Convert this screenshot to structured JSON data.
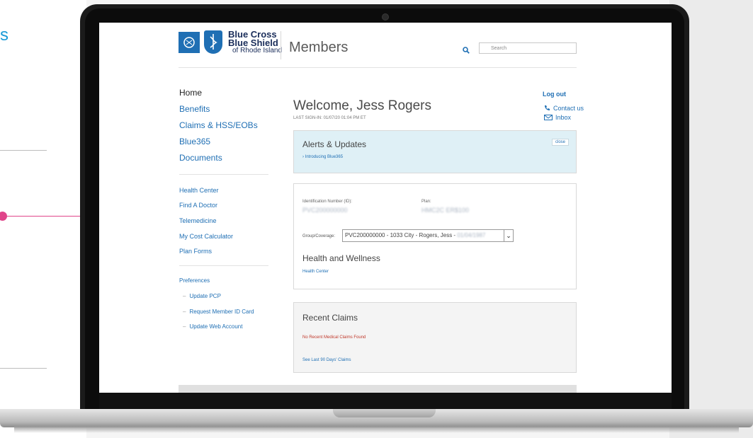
{
  "backdrop": {
    "left_letter": "s",
    "accent_color": "#e0448a",
    "brand_blue": "#1a9bd7"
  },
  "brand": {
    "line1": "Blue Cross",
    "line2": "Blue Shield",
    "line3": "of Rhode Island",
    "logo_icons": [
      "cross-icon",
      "shield-icon"
    ],
    "color": "#1f6fb4"
  },
  "header": {
    "section": "Members",
    "search_placeholder": "Search"
  },
  "sidebar": {
    "primary": [
      "Home",
      "Benefits",
      "Claims & HSS/EOBs",
      "Blue365",
      "Documents"
    ],
    "secondary": [
      "Health Center",
      "Find A Doctor",
      "Telemedicine",
      "My Cost Calculator",
      "Plan Forms"
    ],
    "preferences_title": "Preferences",
    "preferences": [
      "Update PCP",
      "Request Member ID Card",
      "Update Web Account"
    ]
  },
  "account": {
    "logout": "Log out",
    "contact": "Contact us",
    "inbox": "Inbox"
  },
  "welcome": {
    "title": "Welcome, Jess Rogers",
    "last_sign_in": "LAST SIGN-IN: 01/07/20 01:04 PM ET"
  },
  "alerts": {
    "title": "Alerts & Updates",
    "close": "close",
    "link": "› Introducing Blue365"
  },
  "coverage": {
    "id_label": "Identification Number (ID):",
    "id_value": "PVC200000000",
    "plan_label": "Plan:",
    "plan_value": "HMC2C ER$100",
    "group_label": "Group/Coverage:",
    "group_value": "PVC200000000 - 1033 City - Rogers, Jess - ",
    "group_value_blurred": "01/04/1987",
    "health_title": "Health and Wellness",
    "health_link": "Health Center"
  },
  "claims": {
    "title": "Recent Claims",
    "none": "No Recent Medical Claims Found",
    "link": "See Last 90 Days' Claims"
  }
}
